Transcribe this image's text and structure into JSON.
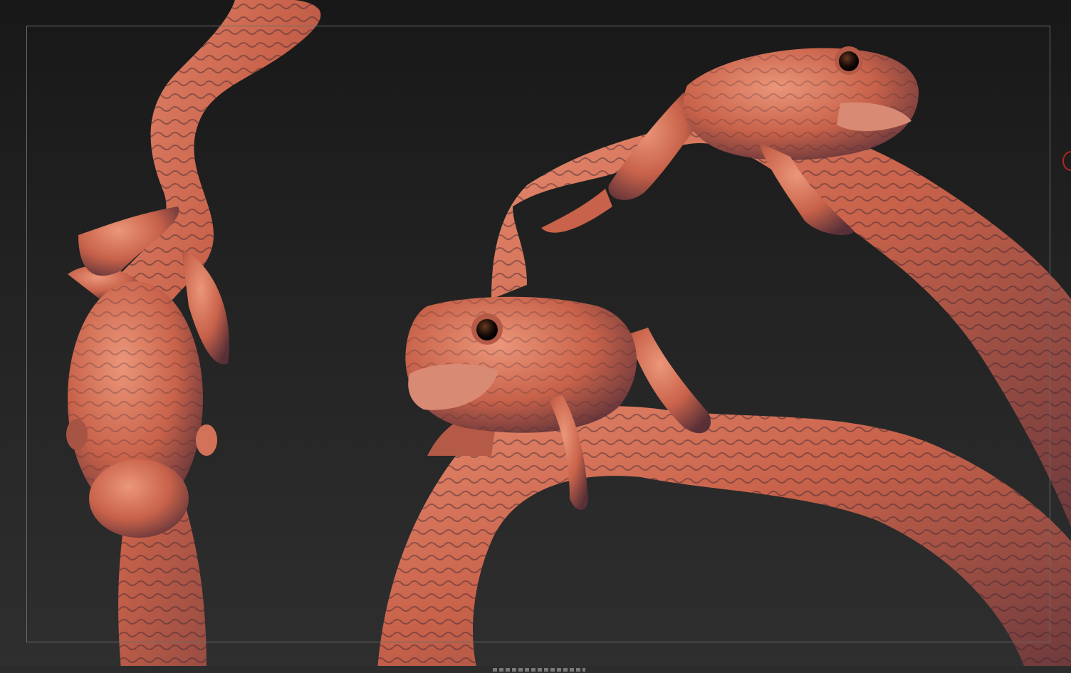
{
  "viewport": {
    "mode": "sculpt-render",
    "background_top": "#181818",
    "background_bottom": "#2f2f2f",
    "frame_color": "#6b6b6b"
  },
  "material": {
    "base": "#c8624a",
    "highlight": "#e58a6e",
    "shadow": "#3a2430",
    "cavity": "#2b1d28"
  },
  "models": [
    {
      "id": "frog-top-view",
      "name": "frog",
      "view": "top"
    },
    {
      "id": "frog-upper-right",
      "name": "frog",
      "view": "side"
    },
    {
      "id": "frog-center",
      "name": "frog",
      "view": "front-three-quarter"
    }
  ],
  "icons": {
    "edge_marker": "circle-marker-icon",
    "bottom_handle": "drag-handle-icon"
  }
}
